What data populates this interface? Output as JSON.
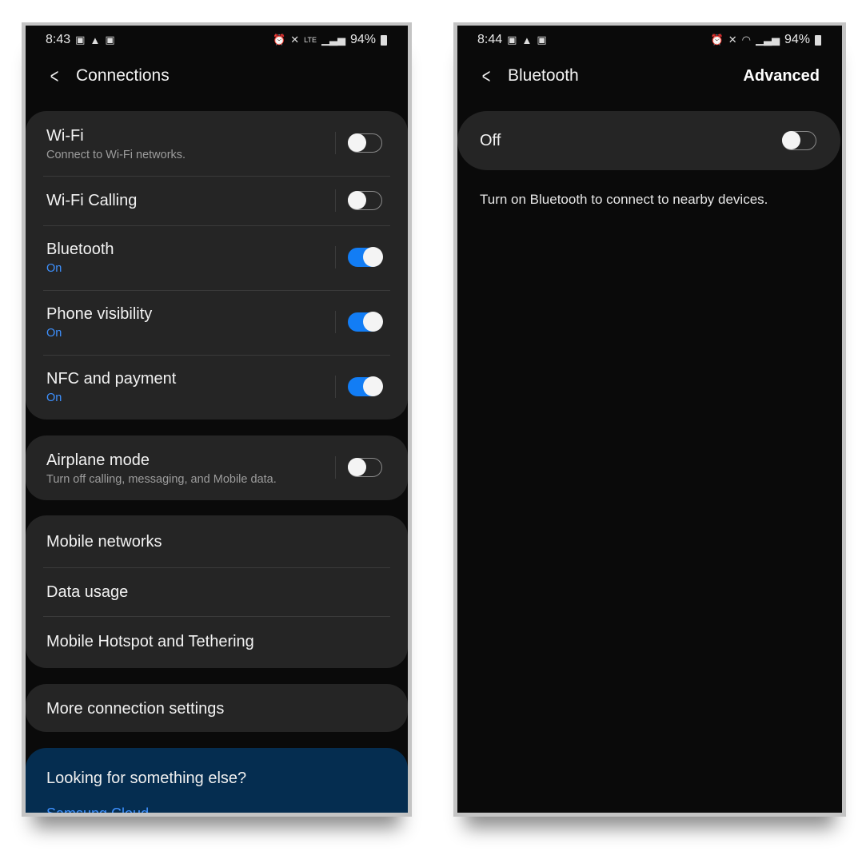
{
  "left": {
    "status": {
      "time": "8:43",
      "battery": "94%",
      "network": "LTE",
      "icons": [
        "gallery-icon",
        "drive-icon",
        "gallery-icon",
        "alarm-icon",
        "mute-icon",
        "lte-icon",
        "signal-icon",
        "battery-icon"
      ]
    },
    "header": {
      "title": "Connections"
    },
    "group1": [
      {
        "label": "Wi-Fi",
        "sub": "Connect to Wi-Fi networks.",
        "on": false
      },
      {
        "label": "Wi-Fi Calling",
        "sub": "",
        "on": false
      },
      {
        "label": "Bluetooth",
        "sub": "On",
        "on": true
      },
      {
        "label": "Phone visibility",
        "sub": "On",
        "on": true
      },
      {
        "label": "NFC and payment",
        "sub": "On",
        "on": true
      }
    ],
    "airplane": {
      "label": "Airplane mode",
      "sub": "Turn off calling, messaging, and Mobile data.",
      "on": false
    },
    "group3": [
      "Mobile networks",
      "Data usage",
      "Mobile Hotspot and Tethering"
    ],
    "more": "More connection settings",
    "suggest": {
      "title": "Looking for something else?",
      "link": "Samsung Cloud"
    }
  },
  "right": {
    "status": {
      "time": "8:44",
      "battery": "94%",
      "icons": [
        "gallery-icon",
        "drive-icon",
        "gallery-icon",
        "alarm-icon",
        "mute-icon",
        "wifi-icon",
        "signal-icon",
        "battery-icon"
      ]
    },
    "header": {
      "title": "Bluetooth",
      "action": "Advanced"
    },
    "master": {
      "label": "Off",
      "on": false
    },
    "hint": "Turn on Bluetooth to connect to nearby devices."
  },
  "colors": {
    "accent": "#127df5",
    "on_text": "#3e91ff",
    "card": "#252525",
    "suggest_bg": "#052d50"
  }
}
